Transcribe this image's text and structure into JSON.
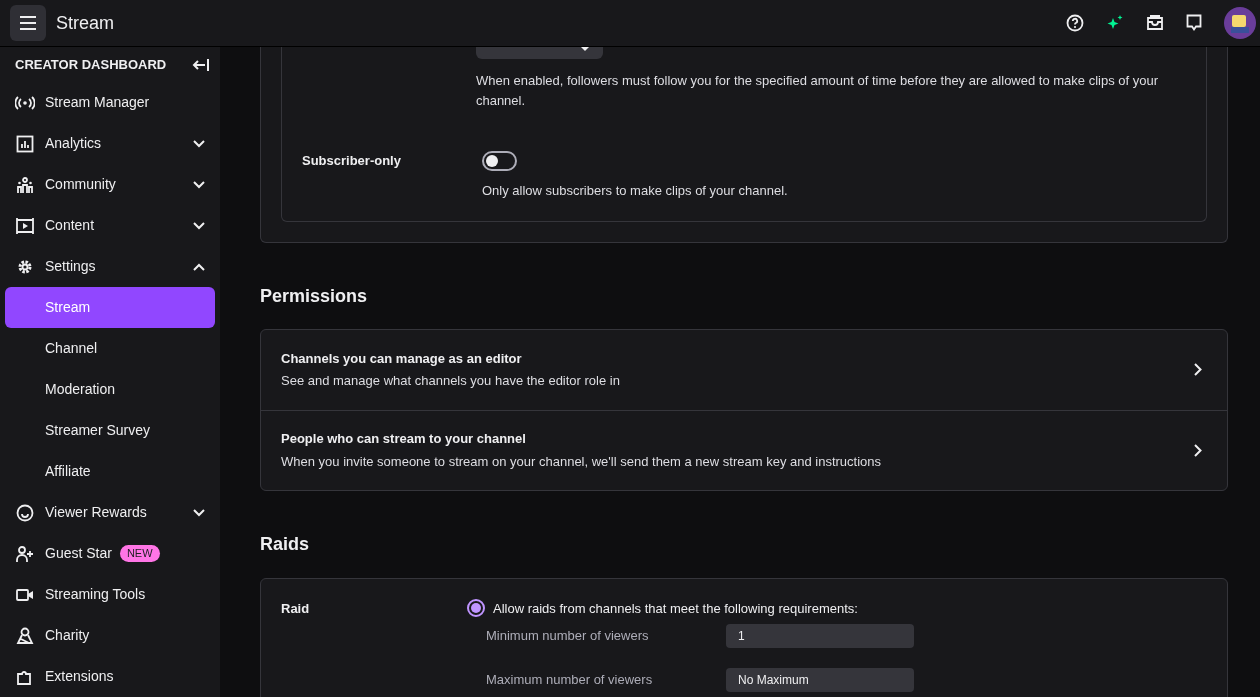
{
  "header": {
    "title": "Stream"
  },
  "sidebar": {
    "title": "CREATOR DASHBOARD",
    "items": [
      {
        "label": "Stream Manager",
        "kind": "link"
      },
      {
        "label": "Analytics",
        "kind": "group",
        "expanded": false
      },
      {
        "label": "Community",
        "kind": "group",
        "expanded": false
      },
      {
        "label": "Content",
        "kind": "group",
        "expanded": false
      },
      {
        "label": "Settings",
        "kind": "group",
        "expanded": true,
        "children": [
          {
            "label": "Stream",
            "selected": true
          },
          {
            "label": "Channel",
            "selected": false
          },
          {
            "label": "Moderation",
            "selected": false
          },
          {
            "label": "Streamer Survey",
            "selected": false
          },
          {
            "label": "Affiliate",
            "selected": false
          }
        ]
      },
      {
        "label": "Viewer Rewards",
        "kind": "group",
        "expanded": false
      },
      {
        "label": "Guest Star",
        "kind": "link",
        "badge": "NEW"
      },
      {
        "label": "Streaming Tools",
        "kind": "link"
      },
      {
        "label": "Charity",
        "kind": "link"
      },
      {
        "label": "Extensions",
        "kind": "link"
      }
    ]
  },
  "clips": {
    "follow_description": "When enabled, followers must follow you for the specified amount of time before they are allowed to make clips of your channel.",
    "subscriber_only": {
      "label": "Subscriber-only",
      "on": false,
      "description": "Only allow subscribers to make clips of your channel."
    }
  },
  "permissions": {
    "heading": "Permissions",
    "rows": [
      {
        "title": "Channels you can manage as an editor",
        "description": "See and manage what channels you have the editor role in"
      },
      {
        "title": "People who can stream to your channel",
        "description": "When you invite someone to stream on your channel, we'll send them a new stream key and instructions"
      }
    ]
  },
  "raids": {
    "heading": "Raids",
    "label": "Raid",
    "option": {
      "label": "Allow raids from channels that meet the following requirements:",
      "selected": true
    },
    "fields": [
      {
        "label": "Minimum number of viewers",
        "value": "1"
      },
      {
        "label": "Maximum number of viewers",
        "value": "No Maximum"
      }
    ]
  }
}
